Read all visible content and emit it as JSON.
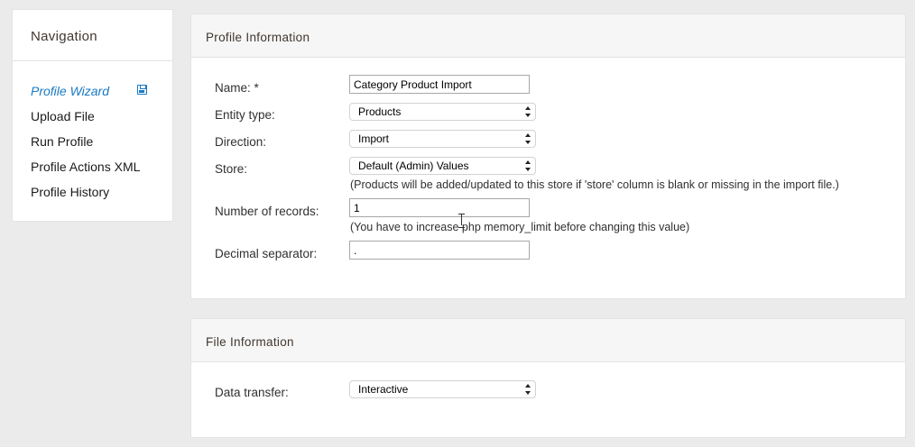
{
  "sidebar": {
    "title": "Navigation",
    "items": [
      {
        "label": "Profile Wizard"
      },
      {
        "label": "Upload File"
      },
      {
        "label": "Run Profile"
      },
      {
        "label": "Profile Actions XML"
      },
      {
        "label": "Profile History"
      }
    ],
    "save_icon": "save-icon"
  },
  "profile_info": {
    "title": "Profile Information",
    "name_label": "Name: *",
    "name_value": "Category Product Import",
    "entity_label": "Entity type:",
    "entity_value": "Products",
    "direction_label": "Direction:",
    "direction_value": "Import",
    "store_label": "Store:",
    "store_value": "Default (Admin) Values",
    "store_note": "(Products will be added/updated to this store if 'store' column is blank or missing in the import file.)",
    "records_label": "Number of records:",
    "records_value": "1",
    "records_note": "(You have to increase php memory_limit before changing this value)",
    "decimal_label": "Decimal separator:",
    "decimal_value": "."
  },
  "file_info": {
    "title": "File Information",
    "transfer_label": "Data transfer:",
    "transfer_value": "Interactive"
  },
  "colors": {
    "accent": "#1979c3",
    "background": "#ebebeb"
  }
}
